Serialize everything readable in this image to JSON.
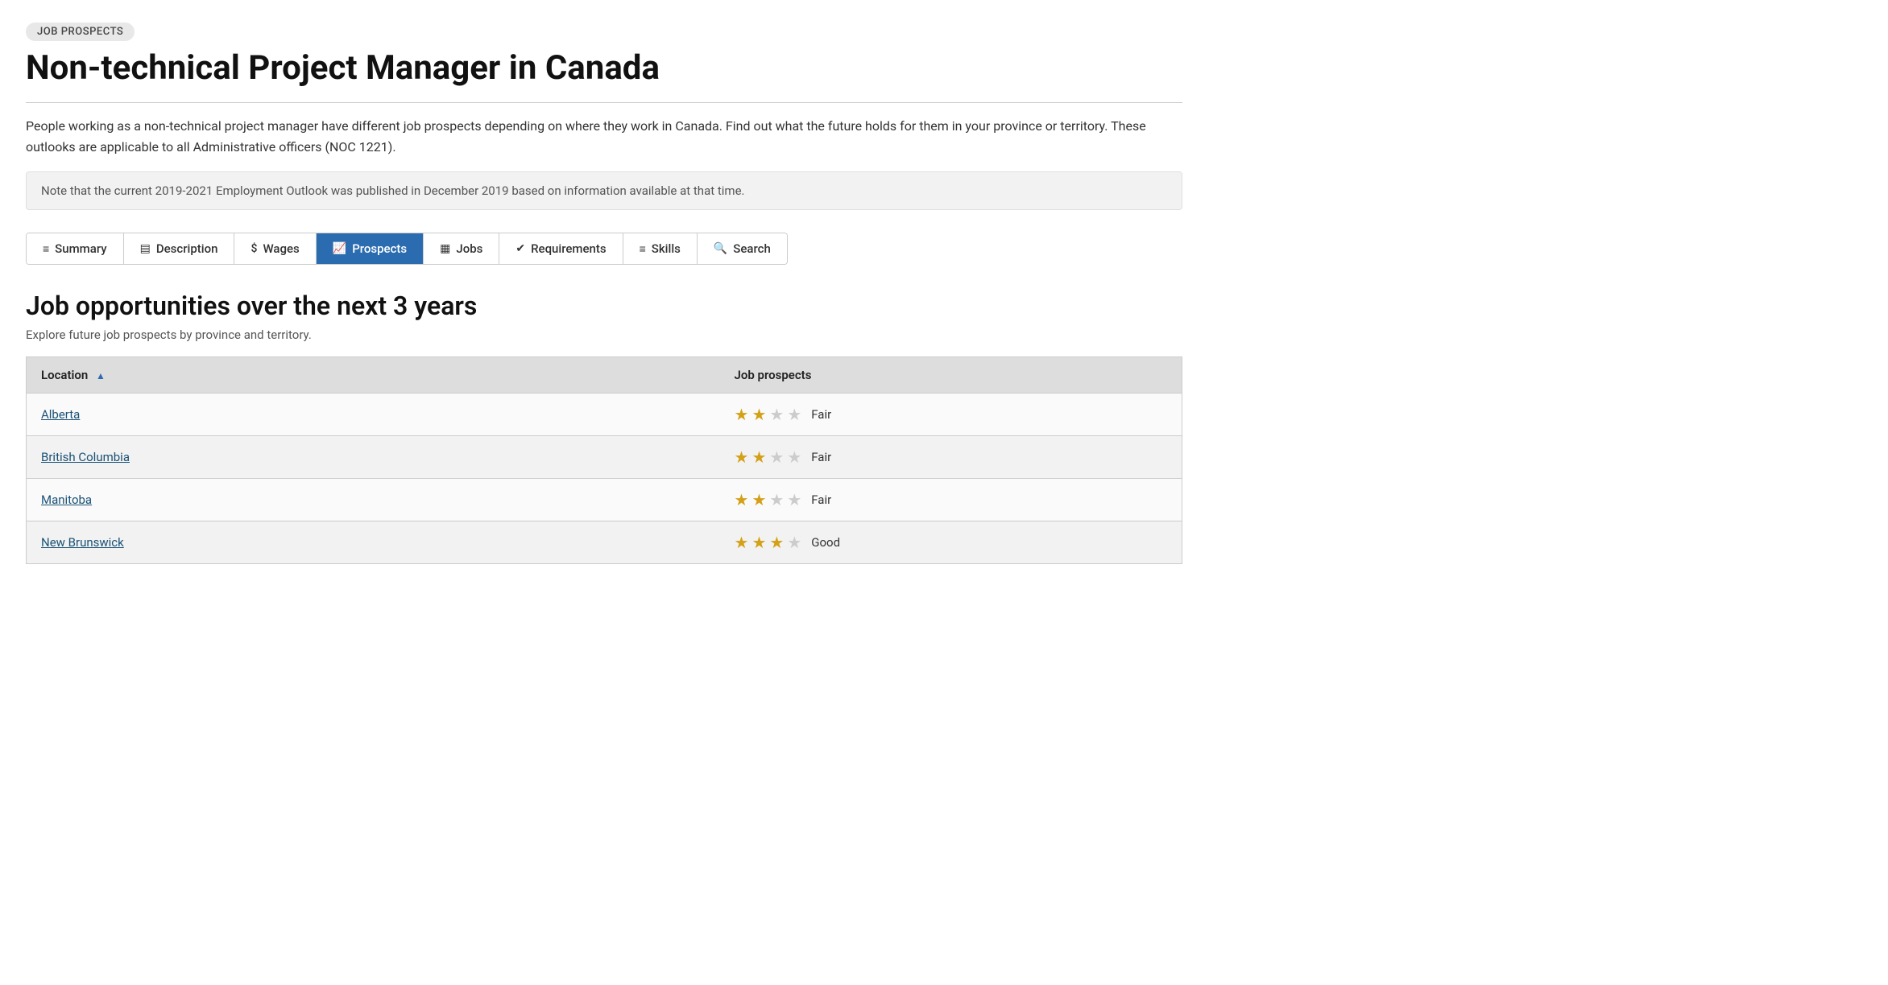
{
  "badge": "JOB PROSPECTS",
  "page_title": "Non-technical Project Manager in Canada",
  "description": "People working as a non-technical project manager have different job prospects depending on where they work in Canada. Find out what the future holds for them in your province or territory. These outlooks are applicable to all Administrative officers (NOC 1221).",
  "note": "Note that the current 2019-2021 Employment Outlook was published in December 2019 based on information available at that time.",
  "tabs": [
    {
      "id": "summary",
      "label": "Summary",
      "icon": "≡",
      "active": false
    },
    {
      "id": "description",
      "label": "Description",
      "icon": "▤",
      "active": false
    },
    {
      "id": "wages",
      "label": "Wages",
      "icon": "$",
      "active": false
    },
    {
      "id": "prospects",
      "label": "Prospects",
      "icon": "📈",
      "active": true
    },
    {
      "id": "jobs",
      "label": "Jobs",
      "icon": "▦",
      "active": false
    },
    {
      "id": "requirements",
      "label": "Requirements",
      "icon": "✔",
      "active": false
    },
    {
      "id": "skills",
      "label": "Skills",
      "icon": "≡",
      "active": false
    },
    {
      "id": "search",
      "label": "Search",
      "icon": "🔍",
      "active": false
    }
  ],
  "section_heading": "Job opportunities over the next 3 years",
  "section_subtext": "Explore future job prospects by province and territory.",
  "table": {
    "columns": [
      "Location",
      "Job prospects"
    ],
    "rows": [
      {
        "location": "Alberta",
        "stars": 2,
        "max_stars": 4,
        "label": "Fair"
      },
      {
        "location": "British Columbia",
        "stars": 2,
        "max_stars": 4,
        "label": "Fair"
      },
      {
        "location": "Manitoba",
        "stars": 2,
        "max_stars": 4,
        "label": "Fair"
      },
      {
        "location": "New Brunswick",
        "stars": 3,
        "max_stars": 4,
        "label": "Good"
      }
    ]
  },
  "colors": {
    "active_tab": "#2b6cb0",
    "star_filled": "#d4a017",
    "star_empty": "#ccc",
    "link": "#1a5276"
  }
}
